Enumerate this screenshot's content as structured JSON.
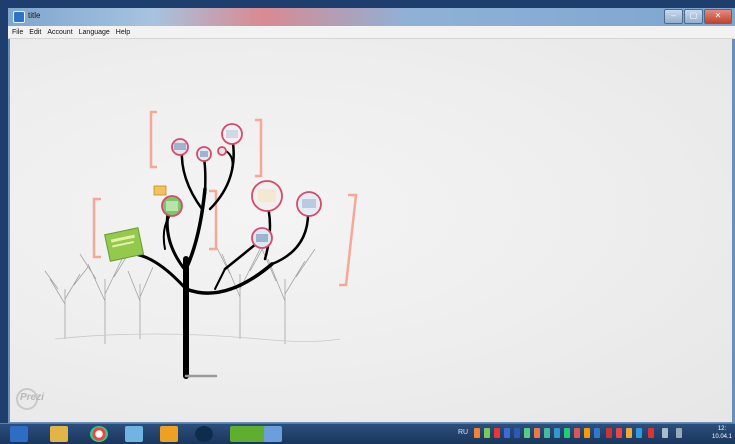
{
  "window": {
    "title": "title",
    "controls": [
      "–",
      "▢",
      "✕"
    ]
  },
  "menu": [
    "File",
    "Edit",
    "Account",
    "Language",
    "Help"
  ],
  "canvas": {
    "brand": "Prezi"
  },
  "taskbar": {
    "apps": [
      "word-icon",
      "explorer-icon",
      "chrome-icon",
      "notes-icon",
      "media-icon",
      "steam-icon",
      "utorrent-icon",
      "window-icon"
    ],
    "language": "RU",
    "clock": {
      "time": "12:",
      "date": "10.04.1"
    }
  },
  "colors": {
    "bracket": "#f6a896",
    "branch": "#000000"
  }
}
